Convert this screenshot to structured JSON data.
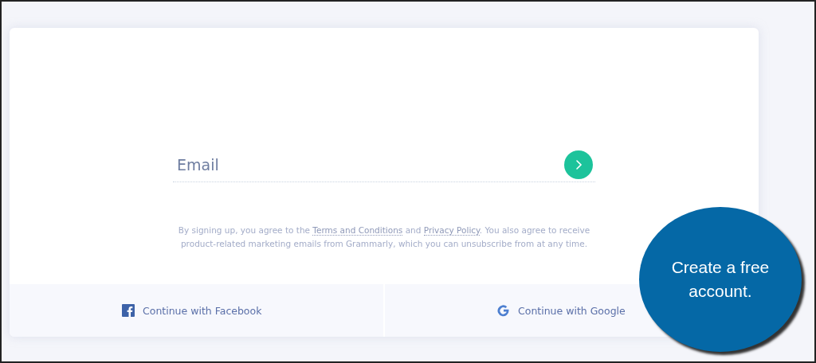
{
  "email_field": {
    "placeholder": "Email"
  },
  "disclaimer": {
    "before": "By signing up, you agree to the ",
    "terms_link": "Terms and Conditions",
    "middle": " and ",
    "privacy_link": "Privacy Policy",
    "after": ". You also agree to receive product-related marketing emails from Grammarly, which you can unsubscribe from at any time."
  },
  "social_buttons": [
    {
      "kind": "facebook",
      "label": "Continue with Facebook"
    },
    {
      "kind": "google",
      "label": "Continue with Google"
    }
  ],
  "callout": {
    "text": "Create a free account."
  }
}
